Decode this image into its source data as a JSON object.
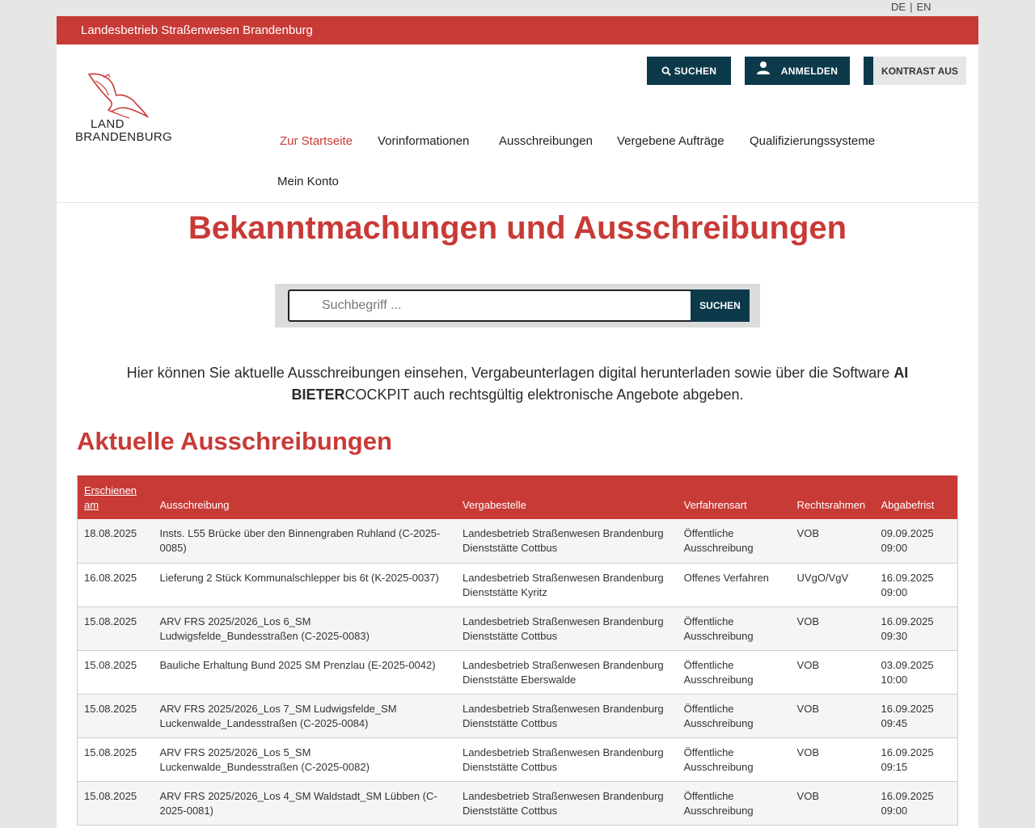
{
  "lang": {
    "de": "DE",
    "sep": "|",
    "en": "EN"
  },
  "topbar": {
    "title": "Landesbetrieb Straßenwesen Brandenburg"
  },
  "logo": {
    "line1": "LAND",
    "line2": "BRANDENBURG"
  },
  "header_buttons": {
    "search": "SUCHEN",
    "login": "ANMELDEN",
    "contrast": "KONTRAST AUS"
  },
  "nav": {
    "items": [
      {
        "label": "Zur Startseite"
      },
      {
        "label": "Vorinformationen"
      },
      {
        "label": "Ausschreibungen"
      },
      {
        "label": "Vergebene Aufträge"
      },
      {
        "label": "Qualifizierungssysteme"
      },
      {
        "label": "Mein Konto"
      }
    ]
  },
  "main": {
    "title": "Bekanntmachungen und Ausschreibungen",
    "search": {
      "placeholder": "Suchbegriff ...",
      "button": "SUCHEN"
    },
    "intro": {
      "part1": "Hier können Sie aktuelle Ausschreibungen einsehen, Vergabeunterlagen digital herunterladen sowie über die Software ",
      "bold1": "AI BIETER",
      "part2": "COCKPIT",
      "part3": " auch rechtsgültig elektronische Angebote abgeben."
    },
    "subtitle": "Aktuelle Ausschreibungen"
  },
  "table": {
    "headers": [
      "Erschienen am",
      "Ausschreibung",
      "Vergabestelle",
      "Verfahrensart",
      "Rechtsrahmen",
      "Abgabefrist"
    ],
    "rows": [
      [
        "18.08.2025",
        "Insts. L55 Brücke über den Binnengraben Ruhland (C-2025-0085)",
        "Landesbetrieb Straßenwesen Brandenburg Dienststätte Cottbus",
        "Öffentliche Ausschreibung",
        "VOB",
        "09.09.2025 09:00"
      ],
      [
        "16.08.2025",
        "Lieferung 2 Stück Kommunalschlepper bis 6t (K-2025-0037)",
        "Landesbetrieb Straßenwesen Brandenburg Dienststätte Kyritz",
        "Offenes Verfahren",
        "UVgO/VgV",
        "16.09.2025 09:00"
      ],
      [
        "15.08.2025",
        "ARV FRS 2025/2026_Los 6_SM Ludwigsfelde_Bundesstraßen (C-2025-0083)",
        "Landesbetrieb Straßenwesen Brandenburg Dienststätte Cottbus",
        "Öffentliche Ausschreibung",
        "VOB",
        "16.09.2025 09:30"
      ],
      [
        "15.08.2025",
        "Bauliche Erhaltung Bund 2025 SM Prenzlau (E-2025-0042)",
        "Landesbetrieb Straßenwesen Brandenburg Dienststätte Eberswalde",
        "Öffentliche Ausschreibung",
        "VOB",
        "03.09.2025 10:00"
      ],
      [
        "15.08.2025",
        "ARV FRS 2025/2026_Los 7_SM Ludwigsfelde_SM Luckenwalde_Landesstraßen (C-2025-0084)",
        "Landesbetrieb Straßenwesen Brandenburg Dienststätte Cottbus",
        "Öffentliche Ausschreibung",
        "VOB",
        "16.09.2025 09:45"
      ],
      [
        "15.08.2025",
        "ARV FRS 2025/2026_Los 5_SM Luckenwalde_Bundesstraßen (C-2025-0082)",
        "Landesbetrieb Straßenwesen Brandenburg Dienststätte Cottbus",
        "Öffentliche Ausschreibung",
        "VOB",
        "16.09.2025 09:15"
      ],
      [
        "15.08.2025",
        "ARV FRS 2025/2026_Los 4_SM Waldstadt_SM Lübben (C-2025-0081)",
        "Landesbetrieb Straßenwesen Brandenburg Dienststätte Cottbus",
        "Öffentliche Ausschreibung",
        "VOB",
        "16.09.2025 09:00"
      ]
    ]
  },
  "colors": {
    "accent": "#c83a36",
    "dark_button": "#0d3a4a",
    "background": "#e6e6e6"
  },
  "icons": {
    "search": "search-icon",
    "user": "user-icon",
    "logo": "eagle-logo-icon"
  }
}
